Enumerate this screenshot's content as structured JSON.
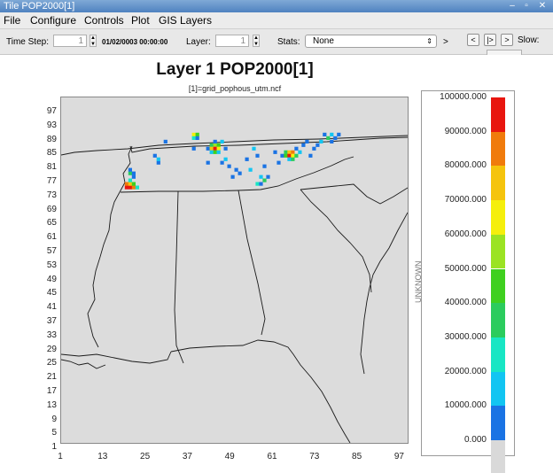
{
  "window": {
    "title": "Tile POP2000[1]"
  },
  "menu": [
    "File",
    "Configure",
    "Controls",
    "Plot",
    "GIS Layers"
  ],
  "toolbar": {
    "time_step_label": "Time Step:",
    "time_step_value": "1",
    "datetime": "01/02/0003 00:00:00",
    "layer_label": "Layer:",
    "layer_value": "1",
    "stats_label": "Stats:",
    "stats_value": "None",
    "stats_arrow": ">",
    "nav_prev": "<",
    "nav_play": "|>",
    "nav_next": ">",
    "slow_label": "Slow:"
  },
  "plot": {
    "title": "Layer 1 POP2000[1]",
    "subtitle": "[1]=grid_pophous_utm.ncf"
  },
  "legend": {
    "unit_label": "UNKNOWN",
    "labels": [
      "100000.000",
      "90000.000",
      "80000.000",
      "70000.000",
      "60000.000",
      "50000.000",
      "40000.000",
      "30000.000",
      "20000.000",
      "10000.000",
      "0.000"
    ],
    "colors": [
      "#e8160f",
      "#f07b0c",
      "#f5c40d",
      "#f5ef0c",
      "#9be323",
      "#3fd01f",
      "#2bcc5d",
      "#18e6c4",
      "#12c5f2",
      "#1a73e4",
      "#d9d9d9"
    ]
  },
  "chart_data": {
    "type": "heatmap",
    "y_ticks": [
      "97",
      "93",
      "89",
      "85",
      "81",
      "77",
      "73",
      "69",
      "65",
      "61",
      "57",
      "53",
      "49",
      "45",
      "41",
      "37",
      "33",
      "29",
      "25",
      "21",
      "17",
      "13",
      "9",
      "5",
      "1"
    ],
    "x_ticks": [
      "1",
      "13",
      "25",
      "37",
      "49",
      "61",
      "73",
      "85",
      "97"
    ],
    "xlim": [
      1,
      99
    ],
    "ylim": [
      1,
      99
    ],
    "cells": [
      [
        19,
        73,
        "#e8160f"
      ],
      [
        20,
        73,
        "#e8160f"
      ],
      [
        21,
        73,
        "#f07b0c"
      ],
      [
        19,
        74,
        "#f07b0c"
      ],
      [
        20,
        74,
        "#f5c40d"
      ],
      [
        21,
        74,
        "#3fd01f"
      ],
      [
        20,
        75,
        "#18e6c4"
      ],
      [
        21,
        76,
        "#1a73e4"
      ],
      [
        20,
        77,
        "#2bcc5d"
      ],
      [
        21,
        77,
        "#1a73e4"
      ],
      [
        20,
        78,
        "#1a73e4"
      ],
      [
        22,
        73,
        "#18e6c4"
      ],
      [
        27,
        82,
        "#1a73e4"
      ],
      [
        28,
        80,
        "#1a73e4"
      ],
      [
        28,
        81,
        "#12c5f2"
      ],
      [
        30,
        86,
        "#1a73e4"
      ],
      [
        38,
        88,
        "#f5ef0c"
      ],
      [
        39,
        88,
        "#3fd01f"
      ],
      [
        38,
        87,
        "#18e6c4"
      ],
      [
        39,
        87,
        "#1a73e4"
      ],
      [
        38,
        84,
        "#1a73e4"
      ],
      [
        42,
        84,
        "#1a73e4"
      ],
      [
        43,
        85,
        "#2bcc5d"
      ],
      [
        44,
        85,
        "#9be323"
      ],
      [
        45,
        85,
        "#3fd01f"
      ],
      [
        43,
        84,
        "#f5c40d"
      ],
      [
        44,
        84,
        "#e8160f"
      ],
      [
        45,
        84,
        "#f5ef0c"
      ],
      [
        43,
        83,
        "#12c5f2"
      ],
      [
        44,
        83,
        "#3fd01f"
      ],
      [
        45,
        83,
        "#12c5f2"
      ],
      [
        44,
        86,
        "#1a73e4"
      ],
      [
        46,
        86,
        "#12c5f2"
      ],
      [
        47,
        84,
        "#1a73e4"
      ],
      [
        42,
        80,
        "#1a73e4"
      ],
      [
        46,
        80,
        "#1a73e4"
      ],
      [
        47,
        81,
        "#12c5f2"
      ],
      [
        48,
        79,
        "#1a73e4"
      ],
      [
        50,
        78,
        "#1a73e4"
      ],
      [
        51,
        77,
        "#1a73e4"
      ],
      [
        49,
        76,
        "#1a73e4"
      ],
      [
        55,
        84,
        "#12c5f2"
      ],
      [
        53,
        81,
        "#1a73e4"
      ],
      [
        56,
        82,
        "#1a73e4"
      ],
      [
        58,
        79,
        "#1a73e4"
      ],
      [
        57,
        76,
        "#12c5f2"
      ],
      [
        58,
        75,
        "#2bcc5d"
      ],
      [
        56,
        74,
        "#18e6c4"
      ],
      [
        57,
        74,
        "#1a73e4"
      ],
      [
        59,
        76,
        "#1a73e4"
      ],
      [
        61,
        83,
        "#1a73e4"
      ],
      [
        63,
        82,
        "#1a73e4"
      ],
      [
        64,
        83,
        "#2bcc5d"
      ],
      [
        65,
        83,
        "#f5c40d"
      ],
      [
        66,
        83,
        "#f07b0c"
      ],
      [
        64,
        82,
        "#3fd01f"
      ],
      [
        65,
        82,
        "#e8160f"
      ],
      [
        66,
        82,
        "#f5ef0c"
      ],
      [
        67,
        82,
        "#2bcc5d"
      ],
      [
        65,
        81,
        "#12c5f2"
      ],
      [
        66,
        81,
        "#2bcc5d"
      ],
      [
        67,
        84,
        "#1a73e4"
      ],
      [
        68,
        83,
        "#12c5f2"
      ],
      [
        69,
        85,
        "#1a73e4"
      ],
      [
        70,
        86,
        "#1a73e4"
      ],
      [
        73,
        85,
        "#1a73e4"
      ],
      [
        74,
        86,
        "#12c5f2"
      ],
      [
        75,
        88,
        "#1a73e4"
      ],
      [
        76,
        87,
        "#2bcc5d"
      ],
      [
        77,
        88,
        "#12c5f2"
      ],
      [
        78,
        87,
        "#1a73e4"
      ],
      [
        77,
        86,
        "#1a73e4"
      ],
      [
        79,
        88,
        "#1a73e4"
      ],
      [
        72,
        84,
        "#1a73e4"
      ],
      [
        71,
        82,
        "#1a73e4"
      ],
      [
        62,
        80,
        "#1a73e4"
      ],
      [
        54,
        78,
        "#12c5f2"
      ]
    ]
  }
}
